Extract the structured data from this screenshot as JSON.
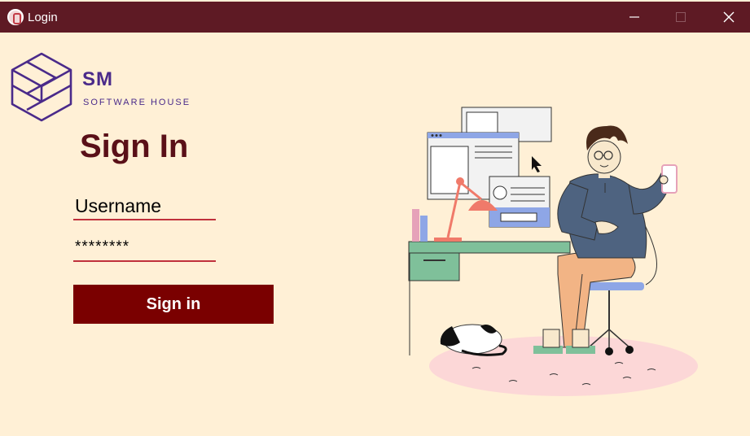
{
  "window": {
    "title": "Login",
    "controls": {
      "minimize": "minimize-icon",
      "maximize": "maximize-icon",
      "close": "close-icon"
    }
  },
  "logo": {
    "initials": "SM",
    "tagline": "SOFTWARE HOUSE",
    "icon": "hexagon-stack-icon",
    "color": "#4a2a8a"
  },
  "form": {
    "heading": "Sign In",
    "username": {
      "placeholder": "Username",
      "value": ""
    },
    "password": {
      "value": "********"
    },
    "submit_label": "Sign in"
  },
  "colors": {
    "titlebar": "#5e1a24",
    "background": "#fff0d6",
    "heading": "#5a1018",
    "underline": "#c0313c",
    "button": "#7a0000"
  },
  "illustration": {
    "icon": "person-at-desk-illustration"
  }
}
